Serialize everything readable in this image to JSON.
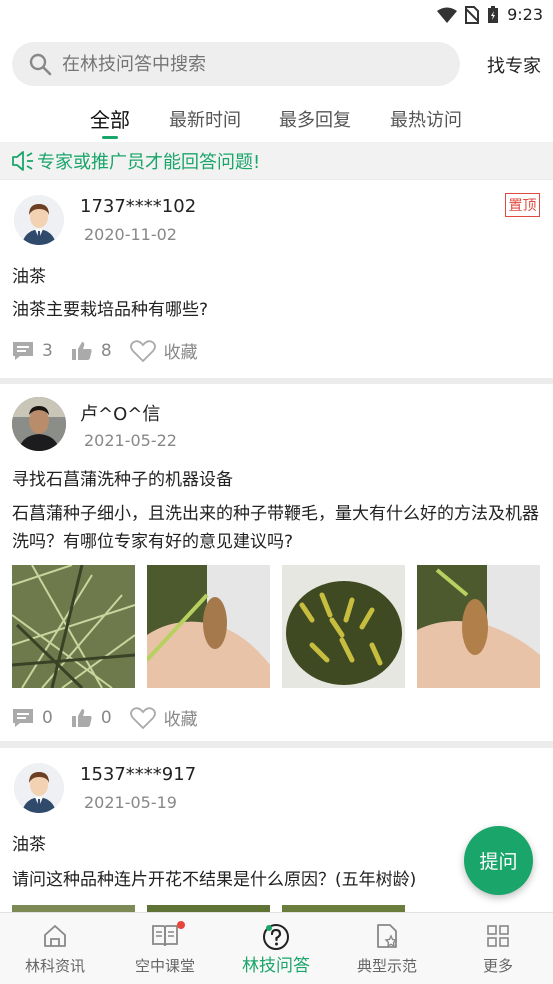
{
  "status_bar": {
    "time": "9:23"
  },
  "search": {
    "placeholder": "在林技问答中搜索",
    "find_expert": "找专家"
  },
  "tabs": [
    {
      "label": "全部",
      "active": true
    },
    {
      "label": "最新时间",
      "active": false
    },
    {
      "label": "最多回复",
      "active": false
    },
    {
      "label": "最热访问",
      "active": false
    }
  ],
  "notice": "专家或推广员才能回答问题!",
  "posts": [
    {
      "user": "1737****102",
      "date": "2020-11-02",
      "pinned_label": "置顶",
      "title": "油茶",
      "body": "油茶主要栽培品种有哪些?",
      "comments": "3",
      "likes": "8",
      "favorite": "收藏"
    },
    {
      "user": "卢^O^信",
      "date": "2021-05-22",
      "title": "寻找石菖蒲洗种子的机器设备",
      "body": "石菖蒲种子细小，且洗出来的种子带鞭毛，量大有什么好的方法及机器洗吗？有哪位专家有好的意见建议吗?",
      "comments": "0",
      "likes": "0",
      "favorite": "收藏"
    },
    {
      "user": "1537****917",
      "date": "2021-05-19",
      "title": "油茶",
      "body": "请问这种品种连片开花不结果是什么原因？(五年树龄)"
    }
  ],
  "fab_label": "提问",
  "bottom_nav": [
    {
      "label": "林科资讯",
      "icon": "home-icon",
      "active": false
    },
    {
      "label": "空中课堂",
      "icon": "book-icon",
      "active": false,
      "badge": true
    },
    {
      "label": "林技问答",
      "icon": "question-icon",
      "active": true
    },
    {
      "label": "典型示范",
      "icon": "document-star-icon",
      "active": false
    },
    {
      "label": "更多",
      "icon": "grid-icon",
      "active": false
    }
  ],
  "colors": {
    "accent": "#1aa56a",
    "pin": "#e04a3f",
    "badge": "#e8453c"
  }
}
